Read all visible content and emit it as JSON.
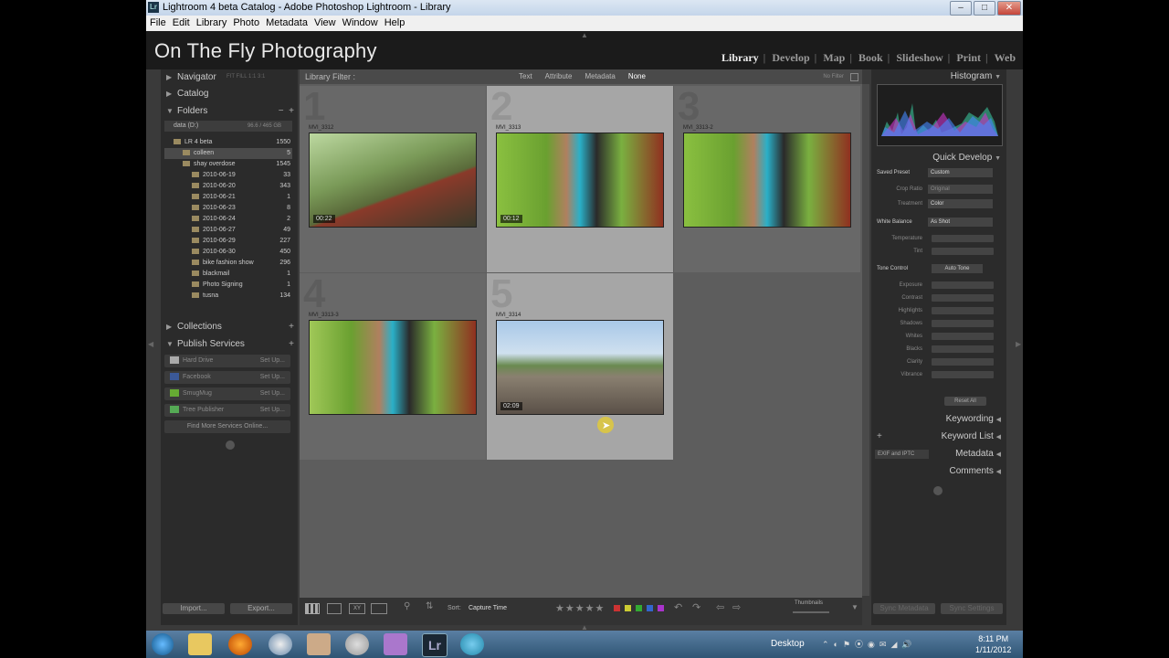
{
  "window": {
    "title": "Lightroom 4 beta Catalog - Adobe Photoshop Lightroom - Library",
    "app_icon": "Lr",
    "controls": [
      "minimize-icon",
      "maximize-icon",
      "close-icon"
    ]
  },
  "menu": [
    "File",
    "Edit",
    "Library",
    "Photo",
    "Metadata",
    "View",
    "Window",
    "Help"
  ],
  "identity": {
    "plate": "On The Fly Photography"
  },
  "modules": [
    {
      "label": "Library",
      "active": true
    },
    {
      "label": "Develop"
    },
    {
      "label": "Map"
    },
    {
      "label": "Book"
    },
    {
      "label": "Slideshow"
    },
    {
      "label": "Print"
    },
    {
      "label": "Web"
    }
  ],
  "left_panel": {
    "navigator": {
      "label": "Navigator",
      "zoom_opts": "FIT  FILL  1:1  3:1"
    },
    "catalog": "Catalog",
    "folders": {
      "label": "Folders",
      "volume": "data (D:)",
      "volume_size": "96.6 / 465 GB",
      "items": [
        {
          "name": "LR 4 beta",
          "count": "1550",
          "indent": 1
        },
        {
          "name": "colleen",
          "count": "5",
          "indent": 2,
          "selected": true
        },
        {
          "name": "shay overdose",
          "count": "1545",
          "indent": 2
        },
        {
          "name": "2010-06-19",
          "count": "33",
          "indent": 3
        },
        {
          "name": "2010-06-20",
          "count": "343",
          "indent": 3
        },
        {
          "name": "2010-06-21",
          "count": "1",
          "indent": 3
        },
        {
          "name": "2010-06-23",
          "count": "8",
          "indent": 3
        },
        {
          "name": "2010-06-24",
          "count": "2",
          "indent": 3
        },
        {
          "name": "2010-06-27",
          "count": "49",
          "indent": 3
        },
        {
          "name": "2010-06-29",
          "count": "227",
          "indent": 3
        },
        {
          "name": "2010-06-30",
          "count": "450",
          "indent": 3
        },
        {
          "name": "bike fashion show",
          "count": "296",
          "indent": 3
        },
        {
          "name": "blackmail",
          "count": "1",
          "indent": 3
        },
        {
          "name": "Photo Signing",
          "count": "1",
          "indent": 3
        },
        {
          "name": "tusna",
          "count": "134",
          "indent": 3
        }
      ]
    },
    "collections": "Collections",
    "publish": {
      "label": "Publish Services",
      "services": [
        {
          "name": "Hard Drive",
          "action": "Set Up..."
        },
        {
          "name": "Facebook",
          "action": "Set Up..."
        },
        {
          "name": "SmugMug",
          "action": "Set Up..."
        },
        {
          "name": "Tree Publisher",
          "action": "Set Up..."
        }
      ],
      "find_more": "Find More Services Online..."
    },
    "import": "Import...",
    "export": "Export..."
  },
  "filter_bar": {
    "label": "Library Filter :",
    "tabs": [
      "Text",
      "Attribute",
      "Metadata",
      "None"
    ],
    "active": "None",
    "preset": "No Filter"
  },
  "grid": [
    {
      "index": "1",
      "name": "MVI_3312",
      "badge": "00:22",
      "selected": false
    },
    {
      "index": "2",
      "name": "MVI_3313",
      "badge": "00:12",
      "selected": true
    },
    {
      "index": "3",
      "name": "MVI_3313-2",
      "badge": "",
      "selected": false
    },
    {
      "index": "4",
      "name": "MVI_3313-3",
      "badge": "",
      "selected": false
    },
    {
      "index": "5",
      "name": "MVI_3314",
      "badge": "02:09",
      "selected": true
    }
  ],
  "toolbar": {
    "sort_label": "Sort:",
    "sort_value": "Capture Time",
    "thumbnails": "Thumbnails",
    "colors": [
      "#c33",
      "#cc3",
      "#3a3",
      "#36c",
      "#a3c"
    ]
  },
  "right_panel": {
    "histogram": "Histogram",
    "quick_develop": "Quick Develop",
    "saved_preset": {
      "label": "Saved Preset",
      "value": "Custom"
    },
    "crop_ratio": {
      "label": "Crop Ratio",
      "value": "Original"
    },
    "treatment": {
      "label": "Treatment",
      "value": "Color"
    },
    "white_balance": {
      "label": "White Balance",
      "value": "As Shot"
    },
    "wb_rows": [
      "Temperature",
      "Tint"
    ],
    "tone_control": {
      "label": "Tone Control",
      "value": "Auto Tone"
    },
    "tone_rows": [
      "Exposure",
      "Contrast",
      "Highlights",
      "Shadows",
      "Whites",
      "Blacks",
      "Clarity",
      "Vibrance"
    ],
    "reset": "Reset All",
    "keywording": "Keywording",
    "keyword_list": "Keyword List",
    "metadata": "Metadata",
    "metadata_preset": "EXIF and IPTC",
    "comments": "Comments",
    "sync_metadata": "Sync Metadata",
    "sync_settings": "Sync Settings"
  },
  "taskbar": {
    "desktop": "Desktop",
    "time": "8:11 PM",
    "date": "1/11/2012",
    "lr_icon": "Lr"
  }
}
